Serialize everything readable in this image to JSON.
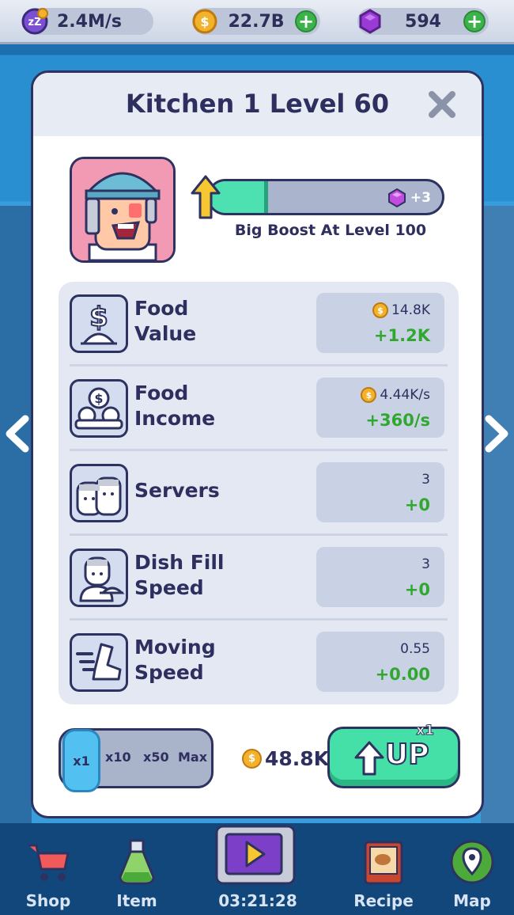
{
  "resources": {
    "sleep_rate": "2.4M/s",
    "coins": "22.7B",
    "gems": "594"
  },
  "modal": {
    "title": "Kitchen 1 Level 60",
    "progress_percent": 25,
    "boost_reward": "+3",
    "boost_label": "Big Boost At Level 100"
  },
  "stats": [
    {
      "name_line1": "Food",
      "name_line2": "Value",
      "current": "14.8K",
      "increase": "+1.2K",
      "icon": "dollar-cloche-icon"
    },
    {
      "name_line1": "Food",
      "name_line2": "Income",
      "current": "4.44K/s",
      "increase": "+360/s",
      "icon": "dollar-dishes-icon"
    },
    {
      "name_line1": "Servers",
      "name_line2": "",
      "current": "3",
      "increase": "+0",
      "icon": "servers-icon"
    },
    {
      "name_line1": "Dish Fill",
      "name_line2": "Speed",
      "current": "3",
      "increase": "+0",
      "icon": "waiter-cloche-icon"
    },
    {
      "name_line1": "Moving",
      "name_line2": "Speed",
      "current": "0.55",
      "increase": "+0.00",
      "icon": "speed-boot-icon"
    }
  ],
  "multiplier": {
    "options": [
      "x1",
      "x10",
      "x50",
      "Max"
    ],
    "selected": "x1"
  },
  "upgrade": {
    "cost": "48.8K",
    "button_label": "UP",
    "button_multiplier": "x1"
  },
  "nav": {
    "shop": "Shop",
    "item": "Item",
    "timer": "03:21:28",
    "recipe": "Recipe",
    "map": "Map"
  },
  "colors": {
    "accent_green": "#45e0a8",
    "increase_green": "#30a82f",
    "dark_outline": "#2e3260",
    "coin_gold": "#f3b22b",
    "gem_purple": "#9b3bd6"
  }
}
